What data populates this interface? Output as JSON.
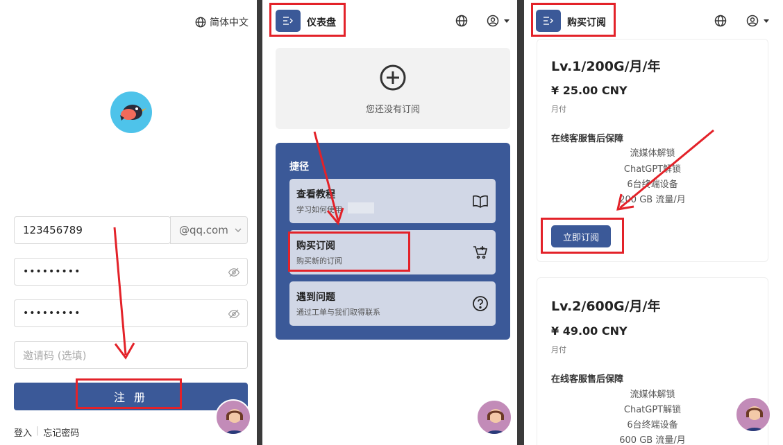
{
  "register": {
    "language_label": "简体中文",
    "username_value": "123456789",
    "email_suffix": "@qq.com",
    "password_masked": "•••••••••",
    "confirm_masked": "•••••••••",
    "invite_placeholder": "邀请码 (选填)",
    "register_button": "注 册",
    "login_link": "登入",
    "forgot_link": "忘记密码"
  },
  "dashboard": {
    "header_title": "仪表盘",
    "empty_text": "您还没有订阅",
    "shortcut_title": "捷径",
    "items": [
      {
        "title": "查看教程",
        "subtitle": "学习如何使用"
      },
      {
        "title": "购买订阅",
        "subtitle": "购买新的订阅"
      },
      {
        "title": "遇到问题",
        "subtitle": "通过工单与我们取得联系"
      }
    ]
  },
  "plans": {
    "header_title": "购买订阅",
    "list": [
      {
        "name": "Lv.1/200G/月/年",
        "price": "¥ 25.00 CNY",
        "period": "月付",
        "features_title": "在线客服售后保障",
        "features": [
          "流媒体解锁",
          "ChatGPT解锁",
          "6台终端设备",
          "200 GB 流量/月"
        ],
        "button": "立即订阅"
      },
      {
        "name": "Lv.2/600G/月/年",
        "price": "¥ 49.00 CNY",
        "period": "月付",
        "features_title": "在线客服售后保障",
        "features": [
          "流媒体解锁",
          "ChatGPT解锁",
          "6台终端设备",
          "600 GB 流量/月"
        ]
      }
    ]
  },
  "colors": {
    "primary": "#3b5998",
    "highlight": "#e32229",
    "card_light": "#d1d7e6"
  }
}
